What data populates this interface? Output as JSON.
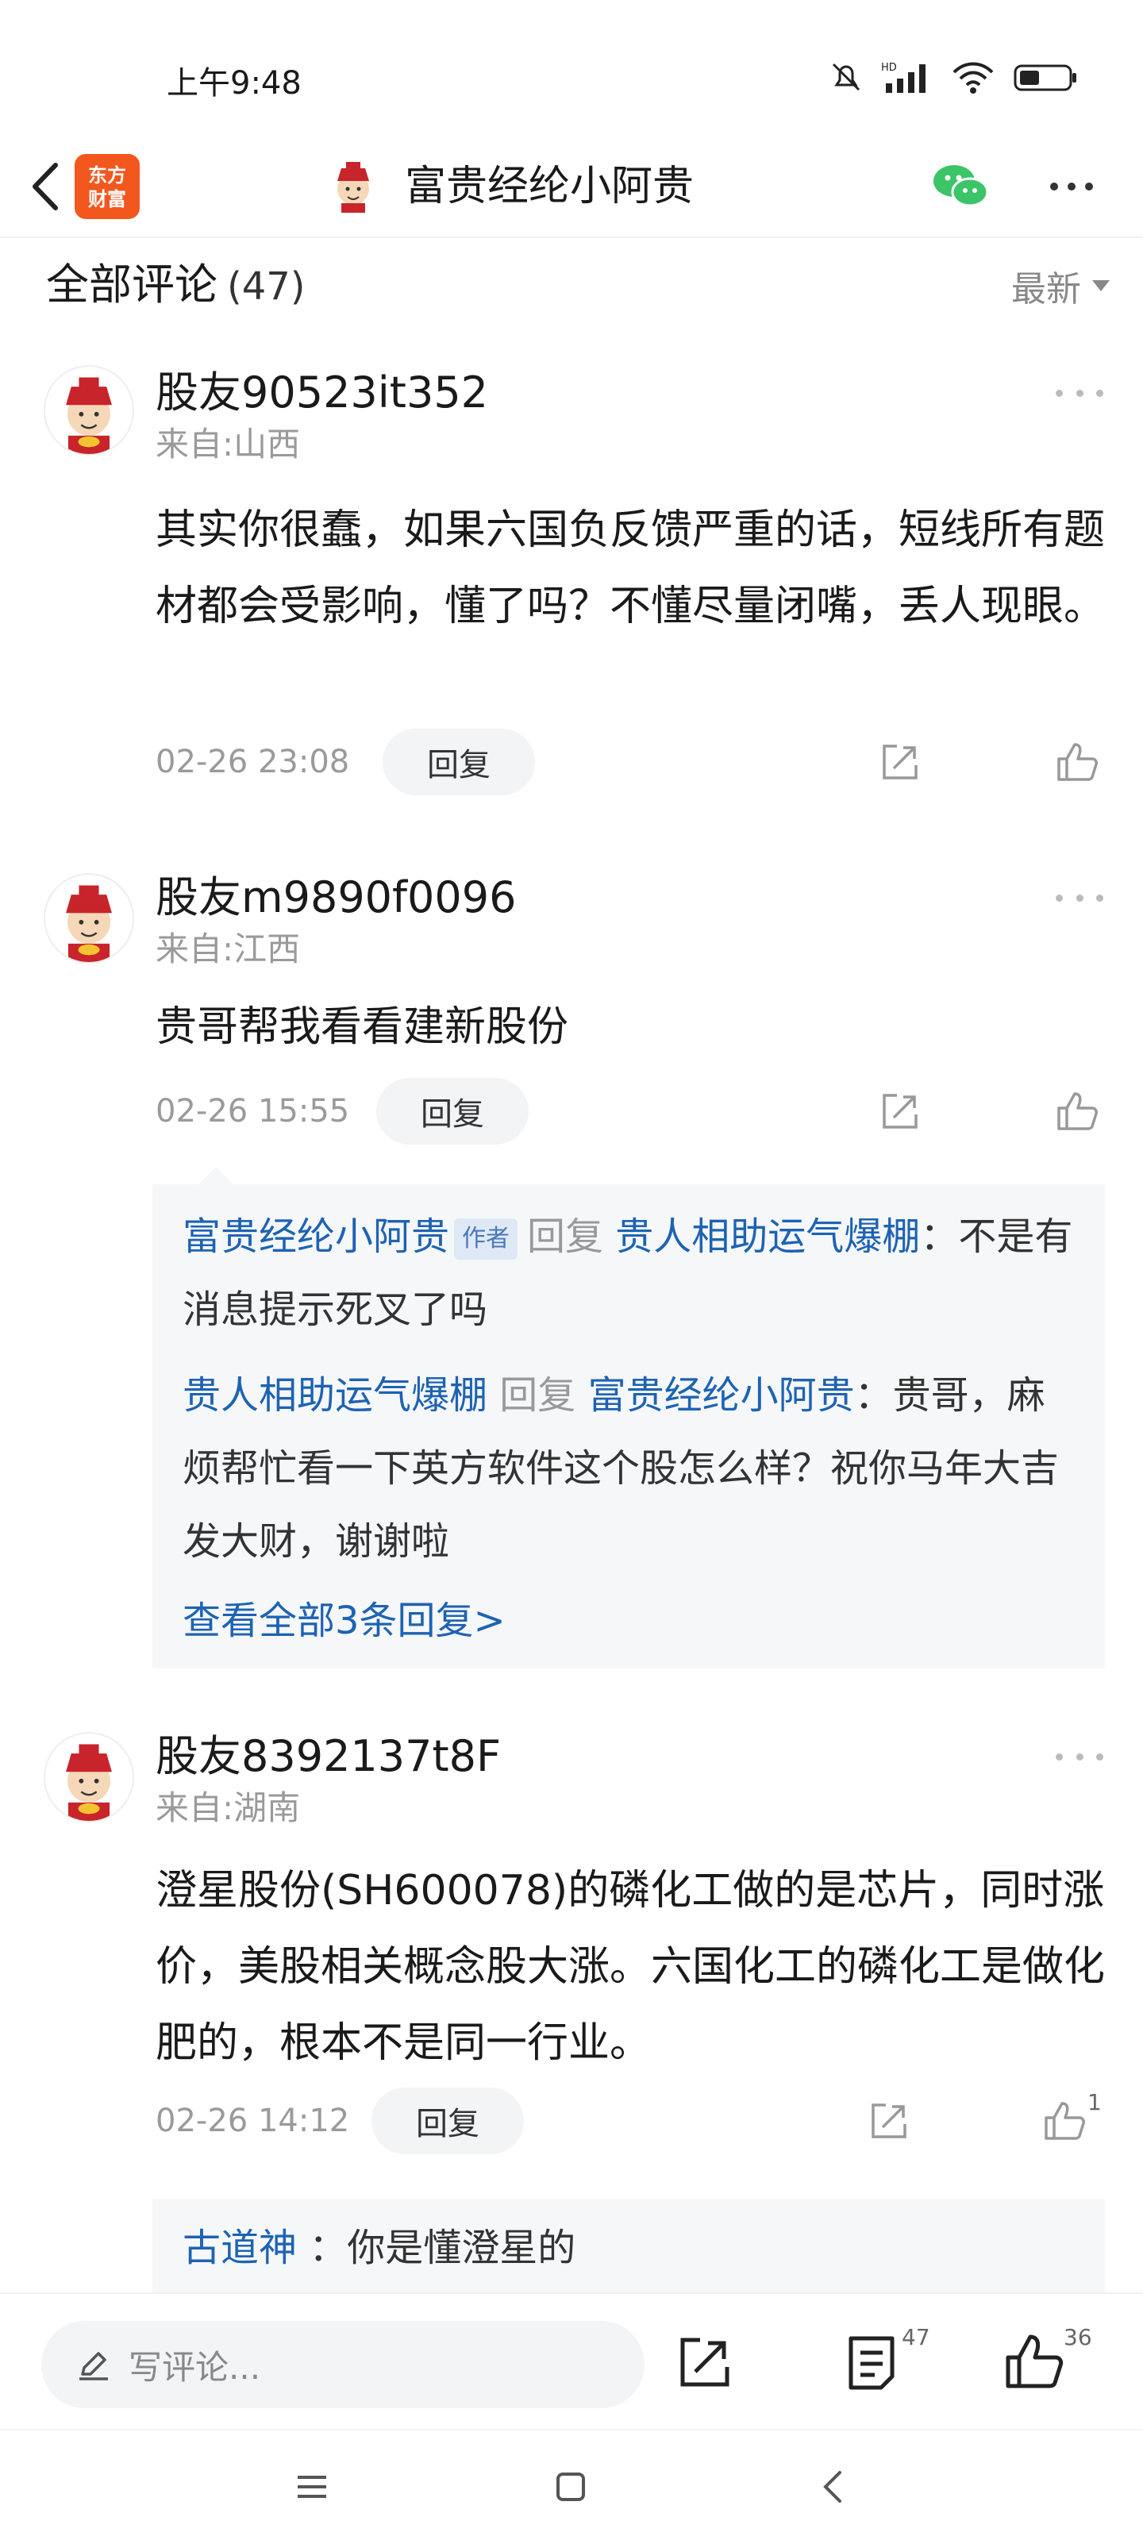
{
  "status_bar": {
    "time": "上午9:48",
    "hd_label": "HD"
  },
  "nav": {
    "logo_line1": "东方",
    "logo_line2": "财富",
    "title": "富贵经纶小阿贵"
  },
  "comments_header": {
    "title": "全部评论",
    "count": "(47)",
    "sort_label": "最新"
  },
  "comments": [
    {
      "user": "股友90523it352",
      "location": "来自:山西",
      "text": "其实你很蠢，如果六国负反馈严重的话，短线所有题材都会受影响，懂了吗？不懂尽量闭嘴，丢人现眼。",
      "time": "02-26 23:08",
      "reply_label": "回复",
      "likes": ""
    },
    {
      "user": "股友m9890f0096",
      "location": "来自:江西",
      "text": "贵哥帮我看看建新股份",
      "time": "02-26 15:55",
      "reply_label": "回复",
      "likes": "",
      "replies": [
        {
          "from": "富贵经纶小阿贵",
          "tag": "作者",
          "verb": "回复",
          "to": "贵人相助运气爆棚",
          "text": "：不是有消息提示死叉了吗"
        },
        {
          "from": "贵人相助运气爆棚",
          "tag": "",
          "verb": "回复",
          "to": "富贵经纶小阿贵",
          "text": "：贵哥，麻烦帮忙看一下英方软件这个股怎么样？祝你马年大吉发大财，谢谢啦"
        }
      ],
      "view_all": "查看全部3条回复>"
    },
    {
      "user": "股友8392137t8F",
      "location": "来自:湖南",
      "text": "澄星股份(SH600078)的磷化工做的是芯片，同时涨价，美股相关概念股大涨。六国化工的磷化工是做化肥的，根本不是同一行业。",
      "time": "02-26 14:12",
      "reply_label": "回复",
      "likes": "1",
      "replies": [
        {
          "from": "古道神",
          "text": "：你是懂澄星的"
        }
      ]
    }
  ],
  "bottom_bar": {
    "input_placeholder": "写评论...",
    "comment_count": "47",
    "like_count": "36"
  },
  "colors": {
    "link_blue": "#1d63b3",
    "logo_orange": "#f2571e",
    "wechat_green": "#3cc468",
    "gray_text": "#9a9a9a"
  },
  "icons": [
    "back-arrow-icon",
    "app-logo",
    "wechat-icon",
    "more-icon",
    "share-icon",
    "thumbs-up-icon",
    "pencil-icon",
    "comment-list-icon",
    "menu-icon",
    "home-square-icon",
    "back-chevron-icon"
  ]
}
